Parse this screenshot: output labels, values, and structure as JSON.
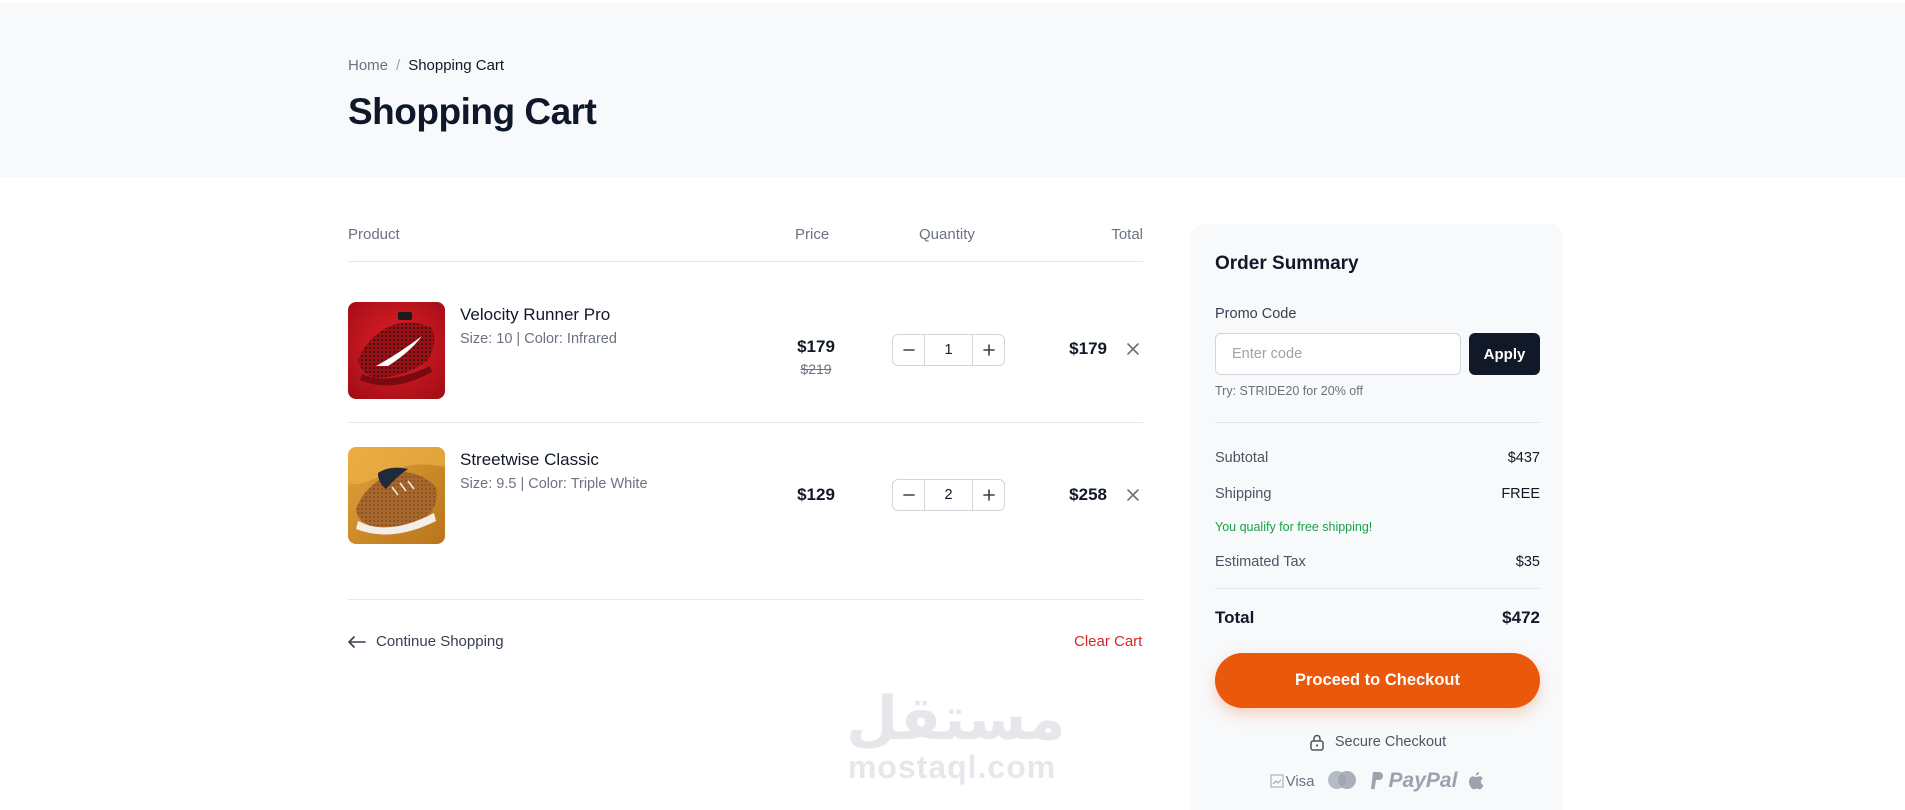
{
  "breadcrumb": {
    "home": "Home",
    "separator": "/",
    "current": "Shopping Cart"
  },
  "page": {
    "title": "Shopping Cart"
  },
  "cart": {
    "headers": {
      "product": "Product",
      "price": "Price",
      "quantity": "Quantity",
      "total": "Total"
    },
    "items": [
      {
        "name": "Velocity Runner Pro",
        "meta": "Size: 10 | Color: Infrared",
        "price": "$179",
        "original_price": "$219",
        "quantity": "1",
        "total": "$179",
        "thumb_color": "#c8121c"
      },
      {
        "name": "Streetwise Classic",
        "meta": "Size: 9.5 | Color: Triple White",
        "price": "$129",
        "original_price": "",
        "quantity": "2",
        "total": "$258",
        "thumb_color": "#d9952b"
      }
    ],
    "continue_label": "Continue Shopping",
    "clear_label": "Clear Cart"
  },
  "summary": {
    "title": "Order Summary",
    "promo_label": "Promo Code",
    "promo_placeholder": "Enter code",
    "apply_label": "Apply",
    "promo_hint": "Try: STRIDE20 for 20% off",
    "subtotal_label": "Subtotal",
    "subtotal_value": "$437",
    "shipping_label": "Shipping",
    "shipping_value": "FREE",
    "free_shipping_note": "You qualify for free shipping!",
    "tax_label": "Estimated Tax",
    "tax_value": "$35",
    "total_label": "Total",
    "total_value": "$472",
    "checkout_label": "Proceed to Checkout",
    "secure_label": "Secure Checkout",
    "payment_visa_alt": "Visa",
    "payment_paypal": "PayPal"
  },
  "watermark": {
    "arabic": "مستقل",
    "latin": "mostaql.com"
  },
  "colors": {
    "accent": "#ea580c",
    "dark": "#111827",
    "danger": "#dc2626",
    "success": "#16a34a"
  }
}
